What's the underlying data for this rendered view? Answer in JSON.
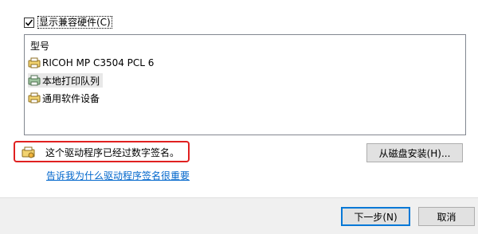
{
  "compat": {
    "checked": true,
    "label": "显示兼容硬件(C)"
  },
  "model_list": {
    "header": "型号",
    "items": [
      {
        "label": "RICOH MP C3504 PCL 6",
        "icon": "printer-icon",
        "selected": false
      },
      {
        "label": "本地打印队列",
        "icon": "network-printer-icon",
        "selected": true
      },
      {
        "label": "通用软件设备",
        "icon": "printer-icon",
        "selected": false
      }
    ]
  },
  "driver": {
    "signed_text": "这个驱动程序已经过数字签名。",
    "signed_icon": "signed-driver-icon",
    "help_link": "告诉我为什么驱动程序签名很重要"
  },
  "buttons": {
    "have_disk": "从磁盘安装(H)...",
    "next": "下一步(N)",
    "cancel": "取消"
  },
  "colors": {
    "accent": "#0078d7",
    "link": "#0066cc",
    "highlight_border": "#e02020"
  }
}
